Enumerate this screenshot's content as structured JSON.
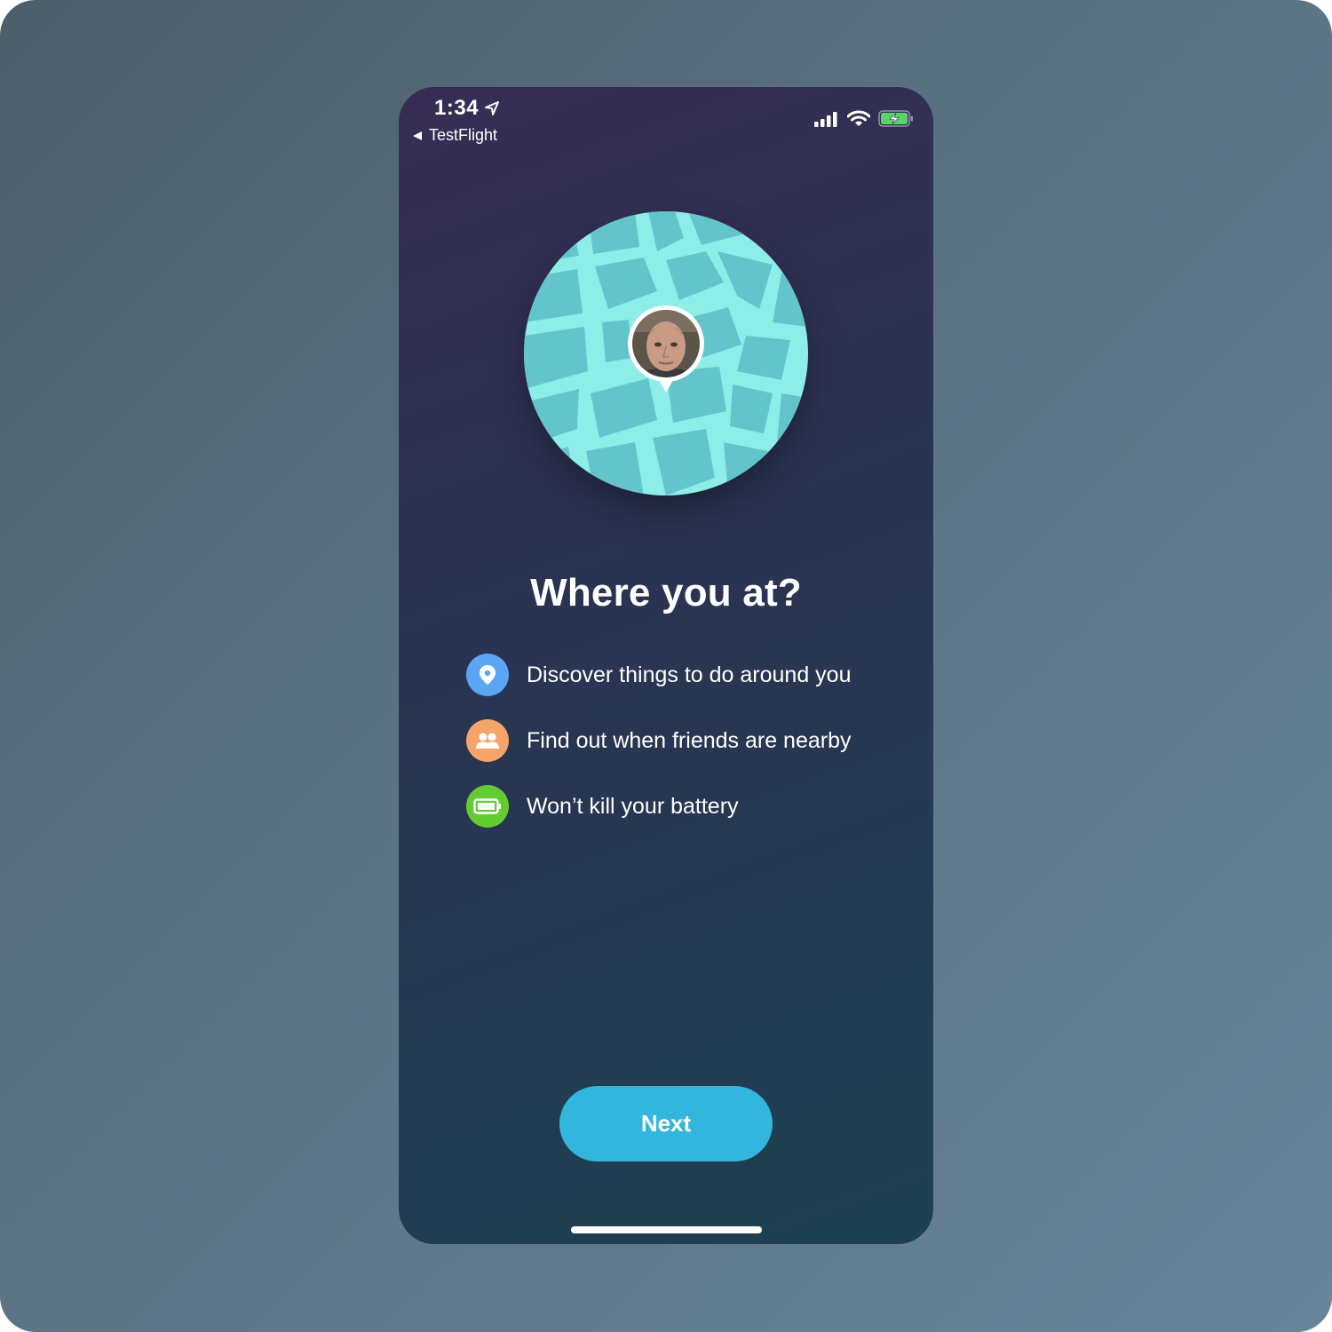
{
  "status_bar": {
    "time": "1:34",
    "back_label": "TestFlight",
    "icons": [
      "location-arrow-icon",
      "cellular-signal-icon",
      "wifi-icon",
      "battery-charging-icon"
    ]
  },
  "hero": {
    "illustration": "map-icon",
    "avatar": "user-avatar-pin"
  },
  "title": "Where you at?",
  "features": [
    {
      "icon": "location-pin-icon",
      "color": "#5aa6f2",
      "text": "Discover things to do around you"
    },
    {
      "icon": "people-icon",
      "color": "#f6a46a",
      "text": "Find out when friends are nearby"
    },
    {
      "icon": "battery-icon",
      "color": "#62cc30",
      "text": "Won’t kill your battery"
    }
  ],
  "next_button": {
    "label": "Next",
    "color": "#33b6dd"
  },
  "colors": {
    "map_base": "#63c4cc",
    "map_roads": "#8eeee7",
    "battery_green": "#5bd26a"
  }
}
